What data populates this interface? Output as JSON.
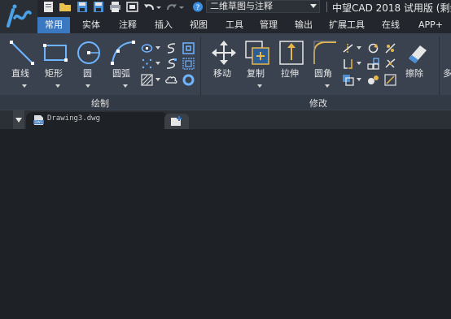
{
  "title_bar": {
    "workspace": "二维草图与注释",
    "app_title": "中望CAD 2018 试用版 (剩余"
  },
  "tabs": [
    {
      "label": "常用",
      "active": true
    },
    {
      "label": "实体"
    },
    {
      "label": "注释"
    },
    {
      "label": "插入"
    },
    {
      "label": "视图"
    },
    {
      "label": "工具"
    },
    {
      "label": "管理"
    },
    {
      "label": "输出"
    },
    {
      "label": "扩展工具"
    },
    {
      "label": "在线"
    },
    {
      "label": "APP+"
    }
  ],
  "ribbon": {
    "draw": {
      "title": "绘制",
      "line": "直线",
      "rect": "矩形",
      "circle": "圆",
      "arc": "圆弧"
    },
    "modify": {
      "title": "修改",
      "move": "移动",
      "copy": "复制",
      "stretch": "拉伸",
      "fillet": "圆角",
      "erase": "擦除"
    },
    "overflow": "多"
  },
  "document": {
    "tab_label": "Drawing3.dwg",
    "icon_text": "DWG"
  },
  "colors": {
    "accent": "#3b78c2",
    "ribbon_bg": "#3a4250",
    "canvas_bg": "#1e2126"
  }
}
